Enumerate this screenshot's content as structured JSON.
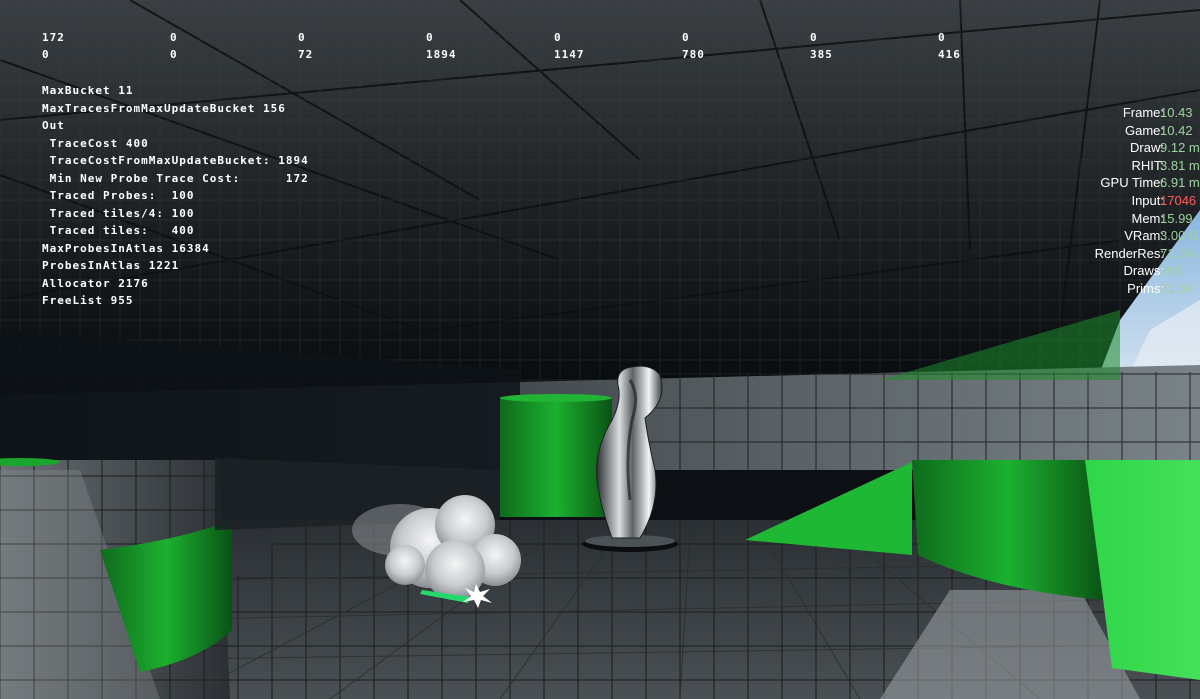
{
  "top_counters": {
    "row1": [
      "172",
      "0",
      "0",
      "0",
      "0",
      "0",
      "0",
      "0"
    ],
    "row2": [
      "0",
      "0",
      "72",
      "1894",
      "1147",
      "780",
      "385",
      "416"
    ]
  },
  "debug_lines": [
    "MaxBucket 11",
    "MaxTracesFromMaxUpdateBucket 156",
    "Out",
    " TraceCost 400",
    " TraceCostFromMaxUpdateBucket: 1894",
    " Min New Probe Trace Cost:      172",
    " Traced Probes:  100",
    " Traced tiles/4: 100",
    " Traced tiles:   400",
    "MaxProbesInAtlas 16384",
    "ProbesInAtlas 1221",
    "Allocator 2176",
    "FreeList 955"
  ],
  "stats": [
    {
      "label": "Frame:",
      "value": "10.43"
    },
    {
      "label": "Game:",
      "value": "10.42"
    },
    {
      "label": "Draw:",
      "value": "9.12 m"
    },
    {
      "label": "RHIT:",
      "value": "3.81 m"
    },
    {
      "label": "GPU Time:",
      "value": "6.91 m"
    },
    {
      "label": "Input:",
      "value": "17046"
    },
    {
      "label": "Mem:",
      "value": "15.99"
    },
    {
      "label": "VRam:",
      "value": "3.00 G"
    },
    {
      "label": "RenderRes:",
      "value": "71.6%"
    },
    {
      "label": "Draws:",
      "value": "595"
    },
    {
      "label": "Prims:",
      "value": "21.5K"
    }
  ],
  "colors": {
    "stat_value": "#9ed49e",
    "stat_value_alert": "#ff5a5a",
    "green_wall": "#22c83a",
    "floor_grey": "#5a6064"
  }
}
